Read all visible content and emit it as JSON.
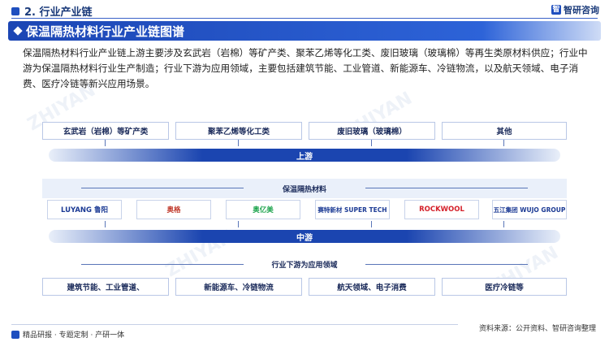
{
  "header": {
    "section_label": "2. 行业产业链",
    "brand": "智研咨询"
  },
  "banner": {
    "title": "保温隔热材料行业产业链图谱"
  },
  "description": "保温隔热材料行业产业链上游主要涉及玄武岩（岩棉）等矿产类、聚苯乙烯等化工类、废旧玻璃（玻璃棉）等再生类原材料供应；行业中游为保温隔热材料行业生产制造；行业下游为应用领域，主要包括建筑节能、工业管道、新能源车、冷链物流，以及航天领域、电子消费、医疗冷链等新兴应用场景。",
  "upstream": {
    "items": [
      "玄武岩（岩棉）等矿产类",
      "聚苯乙烯等化工类",
      "废旧玻璃（玻璃棉）",
      "其他"
    ],
    "label": "上游"
  },
  "midstream": {
    "heading": "保温隔热材料",
    "companies": [
      "LUYANG 鲁阳",
      "奥格",
      "奥亿美",
      "赛特新材 SUPER TECH",
      "ROCKWOOL",
      "五江集团 WUJO GROUP"
    ],
    "label": "中游"
  },
  "downstream": {
    "heading": "行业下游为应用领域",
    "items": [
      "建筑节能、工业管道、",
      "新能源车、冷链物流",
      "航天领域、电子消费",
      "医疗冷链等"
    ]
  },
  "footer": {
    "left": "精品研报 · 专题定制 · 产研一体",
    "source": "资料来源：公开资料、智研咨询整理"
  },
  "colors": {
    "primary": "#1b45b0",
    "panel": "#eaf0fa",
    "rockwool_red": "#d4202a",
    "aoyimei_green": "#1aa34a"
  }
}
